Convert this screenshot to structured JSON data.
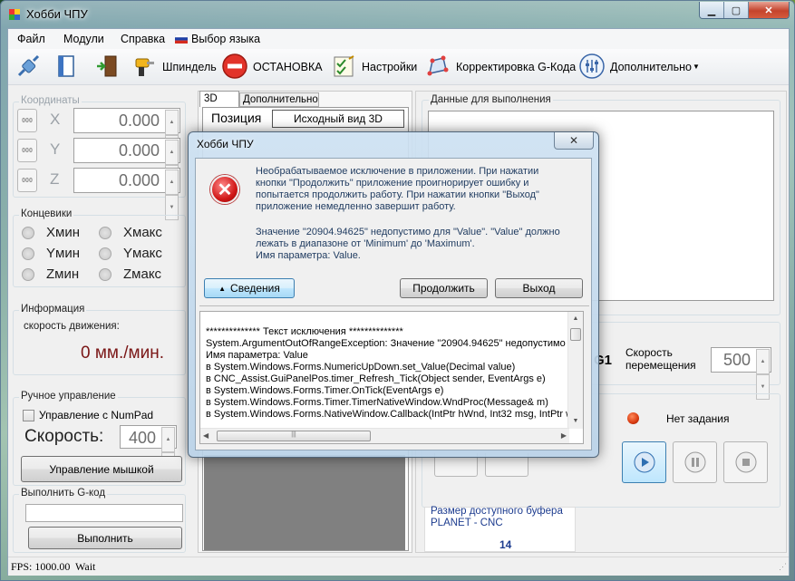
{
  "app": {
    "title": "Хобби ЧПУ"
  },
  "menu": {
    "items": [
      "Файл",
      "Модули",
      "Справка",
      "Выбор языка"
    ]
  },
  "toolbar": {
    "spindle_label": "Шпиндель",
    "stop_label": "ОСТАНОВКА",
    "settings_label": "Настройки",
    "gcode_correction_label": "Корректировка G-Кода",
    "more_label": "Дополнительно"
  },
  "coordinates": {
    "title": "Координаты",
    "zero_label": "000",
    "axes": [
      {
        "name": "X",
        "value": "0.000"
      },
      {
        "name": "Y",
        "value": "0.000"
      },
      {
        "name": "Z",
        "value": "0.000"
      }
    ]
  },
  "limits": {
    "title": "Концевики",
    "items": [
      "Xмин",
      "Xмакс",
      "Yмин",
      "Yмакс",
      "Zмин",
      "Zмакс"
    ]
  },
  "info": {
    "title": "Информация",
    "speed_caption": "скорость движения:",
    "speed_value": "0 мм./мин."
  },
  "manual": {
    "title": "Ручное управление",
    "numpad_label": "Управление с NumPad",
    "speed_label": "Скорость:",
    "speed_value": "400",
    "mouse_button": "Управление мышкой"
  },
  "execute_gcode": {
    "title": "Выполнить G-код",
    "input_value": "",
    "button": "Выполнить"
  },
  "view_tabs": {
    "tabs": [
      "3D",
      "Дополнительно"
    ],
    "position_label": "Позиция",
    "reset_view_button": "Исходный вид 3D"
  },
  "exec_data": {
    "title": "Данные для выполнения"
  },
  "move": {
    "g1_label": "G1",
    "speed_caption": "Скорость перемещения",
    "speed_value": "500"
  },
  "task": {
    "status": "Нет задания"
  },
  "buffer": {
    "title": "Размер доступного буфера",
    "controller": "PLANET - CNC",
    "value": "14"
  },
  "status": {
    "fps": "FPS: 1000.00",
    "state": "Wait"
  },
  "dialog": {
    "title": "Хобби ЧПУ",
    "message1": [
      "Необрабатываемое исключение в приложении. При нажатии",
      "кнопки \"Продолжить\" приложение проигнорирует ошибку и",
      "попытается продолжить работу. При нажатии кнопки \"Выход\"",
      "приложение немедленно завершит работу."
    ],
    "message2": [
      "Значение \"20904.94625\" недопустимо для \"Value\". \"Value\" должно",
      "лежать в диапазоне от 'Minimum' до 'Maximum'.",
      "Имя параметра: Value."
    ],
    "details_button": "Сведения",
    "continue_button": "Продолжить",
    "exit_button": "Выход",
    "details_lines": [
      "************** Текст исключения **************",
      "System.ArgumentOutOfRangeException: Значение \"20904.94625\" недопустимо д",
      "Имя параметра: Value",
      "   в System.Windows.Forms.NumericUpDown.set_Value(Decimal value)",
      "   в CNC_Assist.GuiPanelPos.timer_Refresh_Tick(Object sender, EventArgs e)",
      "   в System.Windows.Forms.Timer.OnTick(EventArgs e)",
      "   в System.Windows.Forms.Timer.TimerNativeWindow.WndProc(Message& m)",
      "   в System.Windows.Forms.NativeWindow.Callback(IntPtr hWnd, Int32 msg, IntPtr w"
    ]
  }
}
